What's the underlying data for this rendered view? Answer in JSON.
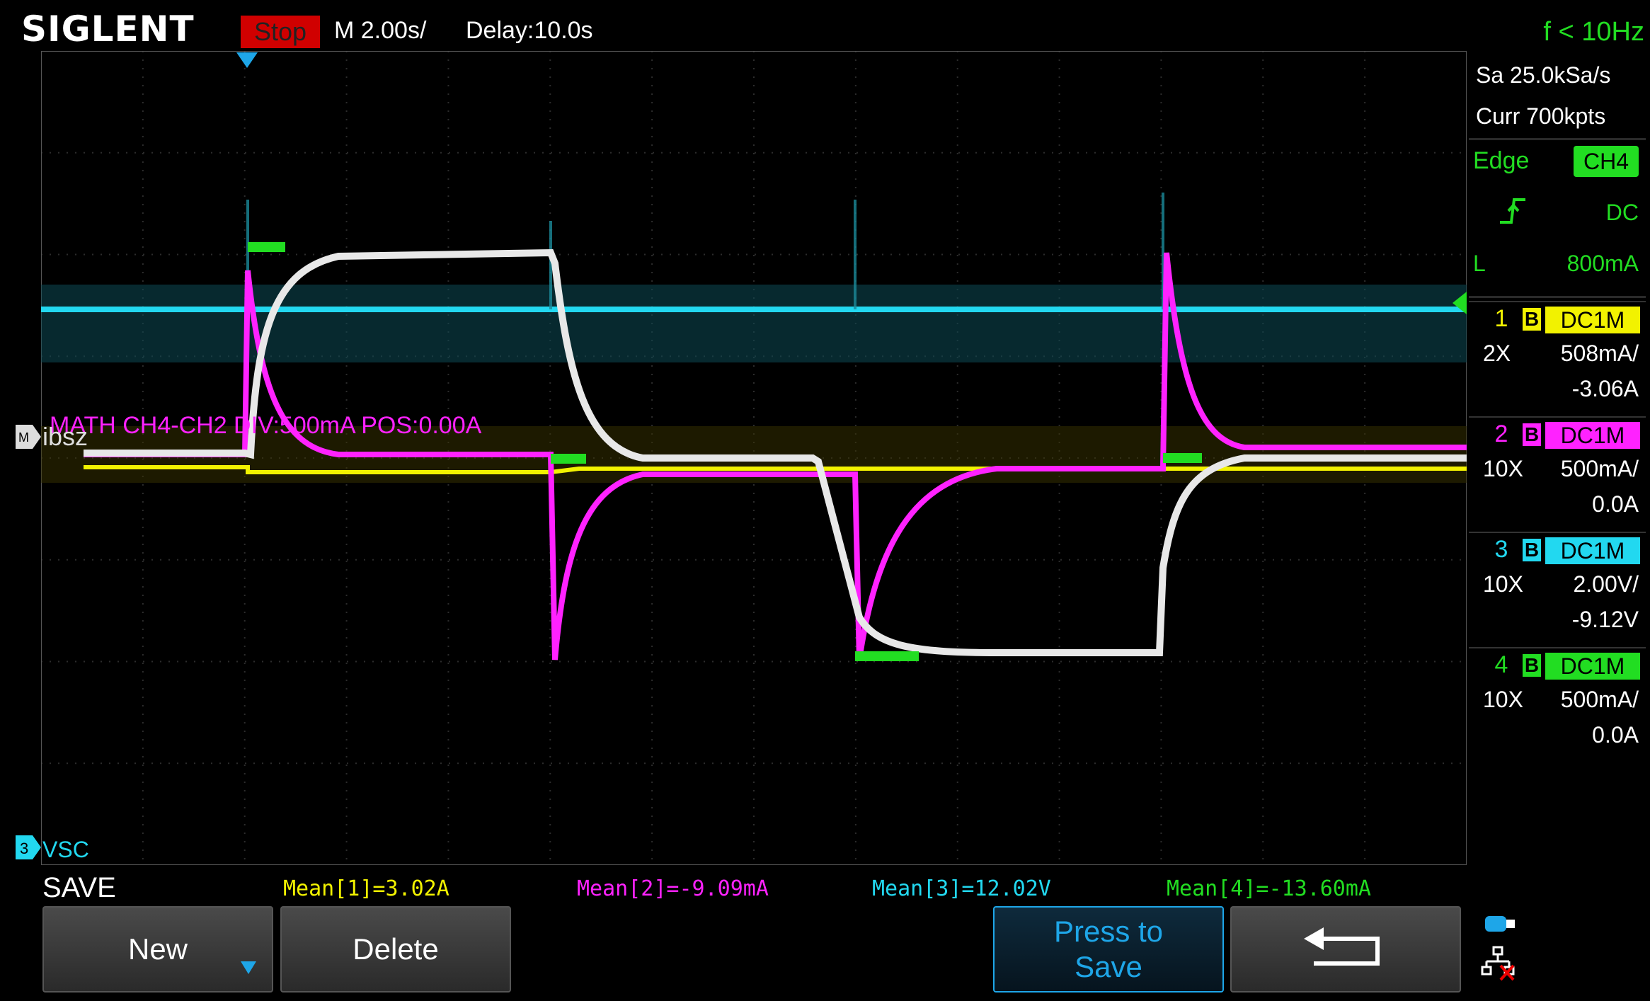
{
  "header": {
    "logo": "SIGLENT",
    "run_state": "Stop",
    "timebase": "M 2.00s/",
    "delay": "Delay:10.0s",
    "trigger_freq": "f < 10Hz"
  },
  "acquisition": {
    "sample_rate": "Sa 25.0kSa/s",
    "memory": "Curr 700kpts"
  },
  "trigger": {
    "type": "Edge",
    "source": "CH4",
    "coupling": "DC",
    "level_prefix": "L",
    "level": "800mA"
  },
  "channels": [
    {
      "num": "1",
      "bw": "B",
      "coupling": "DC1M",
      "probe": "2X",
      "scale": "508mA/",
      "offset": "-3.06A",
      "color": "#f2f200"
    },
    {
      "num": "2",
      "bw": "B",
      "coupling": "DC1M",
      "probe": "10X",
      "scale": "500mA/",
      "offset": "0.0A",
      "color": "#ff22ff"
    },
    {
      "num": "3",
      "bw": "B",
      "coupling": "DC1M",
      "probe": "10X",
      "scale": "2.00V/",
      "offset": "-9.12V",
      "color": "#22d8f0"
    },
    {
      "num": "4",
      "bw": "B",
      "coupling": "DC1M",
      "probe": "10X",
      "scale": "500mA/",
      "offset": "0.0A",
      "color": "#22dd22"
    }
  ],
  "display": {
    "math_label": "MATH  CH4-CH2  DIV:500mA  POS:0.00A",
    "math_marker": "M",
    "ref_label": "ibsz",
    "ch3_marker": "3",
    "ch3_label": "VSC"
  },
  "save_menu": {
    "title": "SAVE",
    "new_label": "New",
    "delete_label": "Delete",
    "press_label_line1": "Press to",
    "press_label_line2": "Save"
  },
  "measurements": [
    {
      "label": "Mean[1]=3.02A",
      "color": "#f2f200"
    },
    {
      "label": "Mean[2]=-9.09mA",
      "color": "#ff22ff"
    },
    {
      "label": "Mean[3]=12.02V",
      "color": "#22d8f0"
    },
    {
      "label": "Mean[4]=-13.60mA",
      "color": "#22dd22"
    }
  ],
  "icons": [
    "trigger-rising-edge-icon",
    "down-arrow-icon",
    "return-arrow-icon",
    "usb-icon",
    "network-disconnected-icon"
  ]
}
